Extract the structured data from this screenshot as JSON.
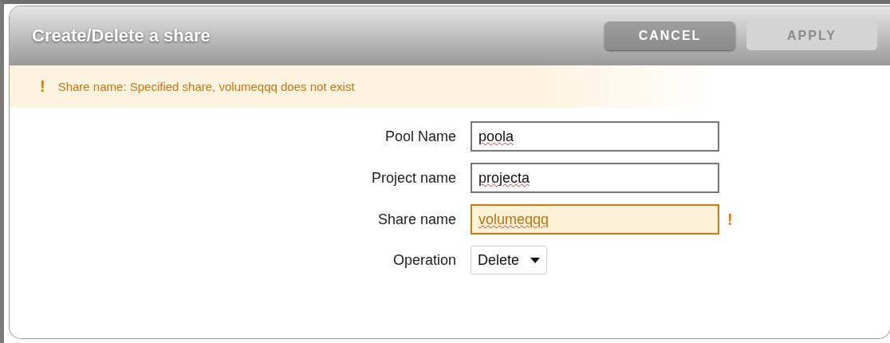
{
  "dialog": {
    "title": "Create/Delete a share"
  },
  "buttons": [
    {
      "label": "CANCEL",
      "disabled": false
    },
    {
      "label": "APPLY",
      "disabled": true
    }
  ],
  "error_banner": {
    "icon": "!",
    "message": "Share name: Specified share, volumeqqq does not exist"
  },
  "fields": [
    {
      "kind": "text",
      "label": "Pool Name",
      "value": "poola",
      "misspelled": true,
      "error": false
    },
    {
      "kind": "text",
      "label": "Project name",
      "value": "projecta",
      "misspelled": true,
      "error": false
    },
    {
      "kind": "text",
      "label": "Share name",
      "value": "volumeqqq",
      "misspelled": true,
      "error": true,
      "error_icon": "!"
    },
    {
      "kind": "select",
      "label": "Operation",
      "value": "Delete"
    }
  ]
}
